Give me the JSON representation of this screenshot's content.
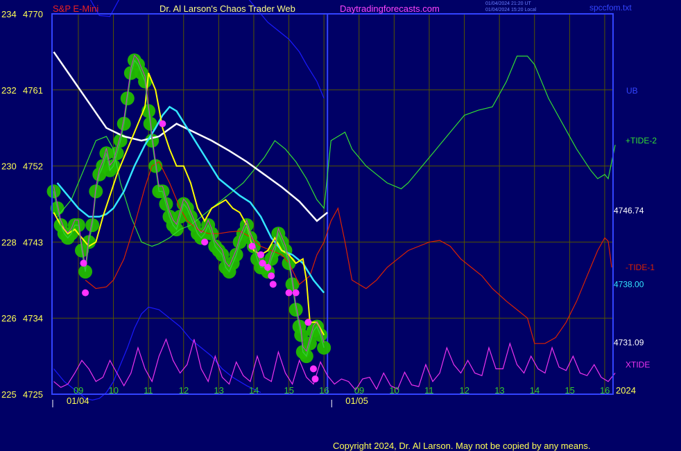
{
  "header": {
    "instrument": "S&P E-Mini",
    "title": "Dr. Al Larson's Chaos Trader Web",
    "site": "Daytradingforecasts.com",
    "utc_line": "01/04/2024 21:20 UT",
    "local_line": "01/04/2024 15:20 Local",
    "file": "spccfom.txt"
  },
  "copyright": "Copyright 2024, Dr. Al Larson. May not be copied by any means.",
  "colors": {
    "background": "#000066",
    "frame": "#3344ff",
    "grid": "#555500",
    "price": "#33cc33",
    "price_halo": "#22bb00",
    "yellow_avg": "#ffff00",
    "cyan_avg": "#33e6ff",
    "white_avg": "#ffffff",
    "tide1": "#dd2200",
    "tide2": "#33dd33",
    "ub": "#1a1aff",
    "xtide": "#ee33ee",
    "markers": "#ff33ff"
  },
  "chart_data": {
    "type": "line",
    "x_unit": "hour",
    "days": [
      {
        "label": "01/04",
        "start_hour": 8.25
      },
      {
        "label": "01/05",
        "start_hour": 16.2
      }
    ],
    "xticks": [
      "09",
      "10",
      "11",
      "12",
      "13",
      "14",
      "15",
      "16",
      "09",
      "10",
      "11",
      "12",
      "13",
      "14",
      "15",
      "16"
    ],
    "year_label": "2024",
    "yaxis": {
      "left_labels": [
        {
          "a": "234",
          "b": "4770",
          "value": 4770
        },
        {
          "a": "232",
          "b": "4761",
          "value": 4761
        },
        {
          "a": "230",
          "b": "4752",
          "value": 4752
        },
        {
          "a": "228",
          "b": "4743",
          "value": 4743
        },
        {
          "a": "226",
          "b": "4734",
          "value": 4734
        },
        {
          "a": "225",
          "b": "4725",
          "value": 4725
        }
      ],
      "ylim": [
        4725,
        4770
      ]
    },
    "right_values": [
      {
        "text": "4746.74",
        "value": 4746.74,
        "color": "#ffffff"
      },
      {
        "text": "4738.00",
        "value": 4738.0,
        "color": "#33e6ff"
      },
      {
        "text": "4731.09",
        "value": 4731.09,
        "color": "#ffffff"
      }
    ],
    "series": [
      {
        "name": "UB",
        "color": "#1a1aff",
        "x": [
          8.3,
          8.6,
          9.0,
          9.2,
          9.4,
          9.6,
          9.8,
          10.0,
          10.2,
          10.4,
          10.6,
          10.8,
          11.0,
          11.3,
          11.6,
          11.9,
          12.2,
          12.5,
          12.8,
          13.1,
          13.4,
          13.8,
          14.2
        ],
        "y": [
          4728,
          4726.5,
          4725.2,
          4724.5,
          4724.3,
          4724.5,
          4725.2,
          4726.5,
          4728.5,
          4730.5,
          4732.8,
          4734.5,
          4735.3,
          4735,
          4734,
          4733,
          4731.5,
          4730.5,
          4729.5,
          4728,
          4727,
          4726,
          4725.2
        ]
      },
      {
        "name": "UB-upper",
        "color": "#1a1aff",
        "x": [
          9.3,
          9.6,
          9.9,
          10.2,
          10.5,
          10.8,
          11.1,
          11.4,
          11.7,
          12.0,
          12.3,
          12.6,
          12.9,
          13.2,
          13.5,
          13.8,
          14.1,
          14.4,
          14.7,
          15.0,
          15.3,
          15.5,
          15.8,
          16.0
        ],
        "y": [
          4772,
          4769.8,
          4769.7,
          4772,
          4776,
          4779,
          4781,
          4783,
          4783,
          4782,
          4781,
          4779,
          4778,
          4776.5,
          4774,
          4772,
          4770.5,
          4769,
          4768,
          4767,
          4765.5,
          4764,
          4762,
          4760
        ]
      },
      {
        "name": "+TIDE-2",
        "color": "#33dd33",
        "label": "+TIDE-2",
        "label_value": 4755,
        "x": [
          8.4,
          8.8,
          9.2,
          9.5,
          9.8,
          10.0,
          10.2,
          10.5,
          10.8,
          11.1,
          11.3,
          11.6,
          11.9,
          12.2,
          12.5,
          12.8,
          13.1,
          13.4,
          13.7,
          14.0,
          14.3,
          14.6,
          14.9,
          15.2,
          15.5,
          15.8,
          16.0,
          16.2,
          16.4,
          16.6,
          16.8,
          17.0,
          17.2,
          17.5,
          17.8,
          18.2,
          18.4,
          18.8,
          19.2,
          19.6,
          20.0,
          20.4,
          20.8,
          21.2,
          21.5,
          21.8,
          22.0,
          22.4,
          22.8,
          23.2,
          23.6,
          23.8,
          24.0,
          24.1,
          24.3
        ],
        "y": [
          4746,
          4748,
          4752,
          4755,
          4755.5,
          4754,
          4750,
          4746,
          4743,
          4742.5,
          4742.8,
          4743.5,
          4744.5,
          4745,
          4746,
          4747,
          4748,
          4749,
          4750,
          4751.5,
          4753,
          4755,
          4754,
          4752.5,
          4750.5,
          4748,
          4747,
          4755,
          4755.5,
          4756,
          4754,
          4753,
          4752,
          4751,
          4750,
          4749.3,
          4750,
          4752,
          4754,
          4756,
          4758,
          4758.6,
          4759,
          4762,
          4765,
          4765,
          4764,
          4760,
          4757,
          4754,
          4751.5,
          4750.5,
          4751,
          4750.5,
          4754.5
        ]
      },
      {
        "name": "-TIDE-1",
        "color": "#dd2200",
        "label": "-TIDE-1",
        "label_value": 4740,
        "x": [
          9.2,
          9.5,
          9.8,
          10.0,
          10.3,
          10.6,
          10.9,
          11.1,
          11.3,
          11.6,
          11.9,
          12.1,
          12.4,
          12.7,
          13.0,
          13.3,
          13.6,
          13.9,
          14.2,
          14.5,
          14.8,
          15.0,
          15.3,
          15.6,
          15.8,
          16.0,
          16.2,
          16.4,
          16.6,
          16.8,
          17.2,
          17.5,
          17.8,
          18.1,
          18.4,
          18.7,
          19.0,
          19.3,
          19.6,
          19.9,
          20.2,
          20.5,
          20.8,
          21.2,
          21.5,
          21.8,
          22.0,
          22.3,
          22.6,
          22.9,
          23.2,
          23.5,
          23.8,
          24.0,
          24.1,
          24.2
        ],
        "y": [
          4738.5,
          4737.5,
          4737.7,
          4738.5,
          4741,
          4745,
          4749.5,
          4752,
          4752.5,
          4750,
          4747,
          4745.5,
          4744.5,
          4744,
          4744,
          4744.2,
          4744.3,
          4743.6,
          4742.5,
          4742,
          4741.5,
          4740.5,
          4738,
          4739,
          4741.5,
          4743,
          4745.5,
          4747,
          4743,
          4738.5,
          4737.5,
          4738.5,
          4740,
          4741,
          4742,
          4742.5,
          4743,
          4743.2,
          4742.5,
          4741,
          4740,
          4739,
          4737.5,
          4736,
          4735,
          4734,
          4731,
          4731,
          4731.7,
          4733.5,
          4736,
          4739,
          4742,
          4743.5,
          4743.1,
          4740
        ]
      },
      {
        "name": "avg-white",
        "color": "#ffffff",
        "x": [
          8.3,
          8.8,
          9.3,
          9.8,
          10.3,
          10.8,
          11.3,
          11.8,
          12.3,
          12.8,
          13.3,
          13.8,
          14.3,
          14.8,
          15.3,
          15.8,
          16.1
        ],
        "y": [
          4765.5,
          4762.5,
          4759.5,
          4756.5,
          4755.5,
          4755,
          4755.5,
          4757,
          4756,
          4755,
          4753.8,
          4752.5,
          4751,
          4749.5,
          4747.8,
          4745.5,
          4746.5
        ]
      },
      {
        "name": "avg-cyan",
        "color": "#33e6ff",
        "x": [
          8.4,
          8.7,
          9.0,
          9.3,
          9.6,
          9.8,
          10.0,
          10.3,
          10.6,
          10.9,
          11.2,
          11.4,
          11.6,
          11.8,
          12.1,
          12.4,
          12.7,
          13.0,
          13.3,
          13.6,
          13.9,
          14.2,
          14.5,
          14.8,
          15.1,
          15.4,
          15.7,
          16.0
        ],
        "y": [
          4750,
          4748.5,
          4747,
          4746,
          4746,
          4746.3,
          4747,
          4749,
          4752,
          4754.5,
          4756.5,
          4758,
          4759,
          4758.5,
          4756.5,
          4754.5,
          4752.5,
          4750.5,
          4749.5,
          4748.5,
          4747.7,
          4746,
          4743.5,
          4742,
          4741.5,
          4740.5,
          4738.5,
          4737
        ]
      },
      {
        "name": "avg-yellow",
        "color": "#ffff00",
        "x": [
          8.3,
          8.5,
          8.7,
          8.9,
          9.1,
          9.3,
          9.5,
          9.7,
          9.9,
          10.1,
          10.3,
          10.5,
          10.7,
          10.9,
          11.0,
          11.2,
          11.4,
          11.6,
          11.8,
          12.0,
          12.2,
          12.4,
          12.6,
          12.8,
          13.0,
          13.2,
          13.4,
          13.6,
          13.8,
          14.0,
          14.2,
          14.4,
          14.6,
          14.8,
          15.0,
          15.2,
          15.4,
          15.5,
          15.6,
          15.8,
          16.0
        ],
        "y": [
          4746.5,
          4745,
          4744,
          4744.5,
          4743.5,
          4742.5,
          4743,
          4746,
          4748.5,
          4751,
          4753,
          4755,
          4757,
          4759,
          4763,
          4761,
          4756.5,
          4754,
          4752,
          4752,
          4750,
          4747,
          4745.5,
          4747,
          4747.5,
          4748,
          4747,
          4746.5,
          4745,
          4742,
          4741.5,
          4742,
          4743.5,
          4742,
          4741.5,
          4740.5,
          4741,
          4738.5,
          4733.5,
          4733.5,
          4732
        ]
      },
      {
        "name": "price",
        "color": "#33cc33",
        "x": [
          8.3,
          8.4,
          8.5,
          8.6,
          8.7,
          8.8,
          8.9,
          9.0,
          9.1,
          9.2,
          9.3,
          9.4,
          9.5,
          9.6,
          9.7,
          9.8,
          9.9,
          10.0,
          10.1,
          10.2,
          10.3,
          10.4,
          10.5,
          10.6,
          10.7,
          10.8,
          10.9,
          11.0,
          11.05,
          11.1,
          11.2,
          11.3,
          11.4,
          11.5,
          11.6,
          11.7,
          11.8,
          11.9,
          12.0,
          12.1,
          12.2,
          12.3,
          12.4,
          12.5,
          12.6,
          12.7,
          12.8,
          12.9,
          13.0,
          13.1,
          13.2,
          13.3,
          13.4,
          13.5,
          13.6,
          13.7,
          13.8,
          13.9,
          14.0,
          14.1,
          14.2,
          14.3,
          14.4,
          14.5,
          14.6,
          14.7,
          14.8,
          14.9,
          15.0,
          15.1,
          15.2,
          15.3,
          15.35,
          15.4,
          15.5,
          15.6,
          15.7,
          15.8,
          15.9,
          16.0
        ],
        "y": [
          4749,
          4747,
          4745,
          4744,
          4743.5,
          4744,
          4745,
          4745,
          4742,
          4739.5,
          4743,
          4745,
          4749,
          4751,
          4752,
          4753.5,
          4751.5,
          4752,
          4753.5,
          4755,
          4757,
          4760,
          4763,
          4764.5,
          4764,
          4763,
          4762,
          4758.5,
          4757,
          4755,
          4752,
          4749,
          4749,
          4747.5,
          4746,
          4745,
          4744.5,
          4746,
          4747.5,
          4747,
          4746,
          4745,
          4744,
          4743.5,
          4744,
          4745,
          4744,
          4742.5,
          4742,
          4741.5,
          4740,
          4739.5,
          4740.5,
          4741.5,
          4743,
          4744,
          4745,
          4743.5,
          4742.5,
          4741,
          4740,
          4740,
          4739.5,
          4741,
          4742,
          4744,
          4743,
          4742,
          4740.5,
          4738,
          4735,
          4733,
          4732,
          4730,
          4729.5,
          4731,
          4732.5,
          4733,
          4732,
          4730.5
        ]
      },
      {
        "name": "XTIDE",
        "color": "#ee33ee",
        "label": "XTIDE",
        "label_value": 4728.5,
        "x": [
          8.3,
          8.5,
          8.7,
          8.9,
          9.1,
          9.3,
          9.5,
          9.7,
          9.9,
          10.1,
          10.3,
          10.5,
          10.7,
          10.9,
          11.1,
          11.3,
          11.5,
          11.7,
          11.9,
          12.1,
          12.3,
          12.5,
          12.7,
          12.9,
          13.1,
          13.3,
          13.5,
          13.7,
          13.9,
          14.1,
          14.3,
          14.5,
          14.7,
          14.9,
          15.1,
          15.3,
          15.5,
          15.7,
          15.9,
          16.1,
          16.3,
          16.5,
          16.7,
          16.9,
          17.1,
          17.3,
          17.5,
          17.7,
          17.9,
          18.1,
          18.3,
          18.5,
          18.7,
          18.9,
          19.1,
          19.3,
          19.5,
          19.7,
          19.9,
          20.1,
          20.3,
          20.5,
          20.7,
          20.9,
          21.1,
          21.3,
          21.5,
          21.7,
          21.9,
          22.1,
          22.3,
          22.5,
          22.7,
          22.9,
          23.1,
          23.3,
          23.5,
          23.7,
          23.9,
          24.1,
          24.3
        ],
        "y": [
          4726.5,
          4725.8,
          4726.2,
          4727.5,
          4729,
          4728,
          4726.5,
          4727,
          4729,
          4727.5,
          4726,
          4727.5,
          4730.5,
          4728,
          4726.5,
          4729.5,
          4731.5,
          4729,
          4727.5,
          4728.5,
          4731.5,
          4728,
          4726.5,
          4729.5,
          4727,
          4726.2,
          4728.8,
          4727.2,
          4726.5,
          4729.5,
          4727,
          4726.5,
          4730,
          4727.5,
          4726.2,
          4729,
          4727,
          4726.2,
          4728.8,
          4727.2,
          4726.2,
          4726.8,
          4726.5,
          4725.5,
          4726.8,
          4727,
          4725.6,
          4727.5,
          4726,
          4725.6,
          4727.6,
          4726.1,
          4725.9,
          4728.5,
          4726.5,
          4727.5,
          4730.5,
          4728.5,
          4727.5,
          4729,
          4727.5,
          4727.2,
          4730.5,
          4728,
          4728,
          4731,
          4728.5,
          4727.5,
          4729.5,
          4728,
          4727.5,
          4730.5,
          4728.2,
          4727.8,
          4729.5,
          4727.5,
          4727.2,
          4728.5,
          4727,
          4726.5,
          4727.5
        ]
      }
    ],
    "markers": [
      {
        "x": 9.15,
        "y": 4740.5
      },
      {
        "x": 9.2,
        "y": 4737
      },
      {
        "x": 11.4,
        "y": 4757
      },
      {
        "x": 12.6,
        "y": 4743
      },
      {
        "x": 13.95,
        "y": 4742.5
      },
      {
        "x": 14.2,
        "y": 4741.5
      },
      {
        "x": 14.25,
        "y": 4740.5
      },
      {
        "x": 14.4,
        "y": 4740
      },
      {
        "x": 14.5,
        "y": 4739
      },
      {
        "x": 14.55,
        "y": 4738
      },
      {
        "x": 15.0,
        "y": 4737
      },
      {
        "x": 15.2,
        "y": 4737
      },
      {
        "x": 15.55,
        "y": 4733.5
      },
      {
        "x": 15.7,
        "y": 4728
      },
      {
        "x": 15.75,
        "y": 4726.8
      }
    ],
    "legend_labels": [
      {
        "text": "UB",
        "value": 4761,
        "color": "#3344ff"
      }
    ]
  }
}
